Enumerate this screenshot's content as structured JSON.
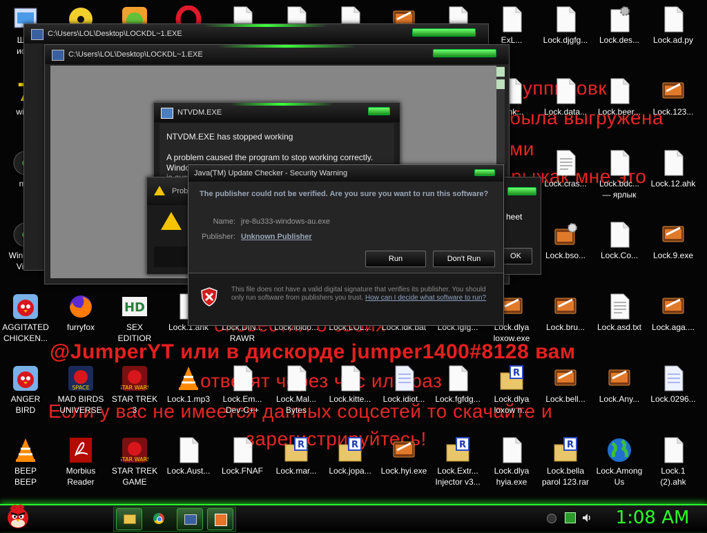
{
  "desktop": {
    "icons": [
      {
        "label": "Шоб\nиспр",
        "kind": "shortcut",
        "col": 0,
        "row": 0
      },
      {
        "label": "",
        "kind": "disc",
        "col": 1,
        "row": 0
      },
      {
        "label": "",
        "kind": "app-green",
        "col": 2,
        "row": 0
      },
      {
        "label": "",
        "kind": "opera",
        "col": 3,
        "row": 0
      },
      {
        "label": "",
        "kind": "file",
        "col": 4,
        "row": 0
      },
      {
        "label": "",
        "kind": "file",
        "col": 5,
        "row": 0
      },
      {
        "label": "",
        "kind": "file",
        "col": 6,
        "row": 0
      },
      {
        "label": "",
        "kind": "script",
        "col": 7,
        "row": 0
      },
      {
        "label": "",
        "kind": "file",
        "col": 8,
        "row": 0
      },
      {
        "label": "ExL...",
        "kind": "file",
        "col": 9,
        "row": 0
      },
      {
        "label": "Lock.djgfg...",
        "kind": "file",
        "col": 10,
        "row": 0
      },
      {
        "label": "Lock.des...",
        "kind": "gear-file",
        "col": 11,
        "row": 0
      },
      {
        "label": "Lock.ad.py",
        "kind": "file",
        "col": 12,
        "row": 0
      },
      {
        "label": "winlo",
        "kind": "seven",
        "col": 0,
        "row": 1
      },
      {
        "label": "elink...",
        "kind": "file",
        "col": 9,
        "row": 1
      },
      {
        "label": "Lock.data...",
        "kind": "file",
        "col": 10,
        "row": 1
      },
      {
        "label": "Lock.beer...",
        "kind": "file",
        "col": 11,
        "row": 1
      },
      {
        "label": "Lock.123...",
        "kind": "script",
        "col": 12,
        "row": 1
      },
      {
        "label": "mis",
        "kind": "disc-dark",
        "col": 0,
        "row": 2
      },
      {
        "label": "Lock.cras...",
        "kind": "doc",
        "col": 10,
        "row": 2
      },
      {
        "label": "Lock.bdc...\n— ярлык",
        "kind": "file",
        "col": 11,
        "row": 2
      },
      {
        "label": "Lock.12.ahk",
        "kind": "file",
        "col": 12,
        "row": 2
      },
      {
        "label": "Windows\nVista",
        "kind": "disc-dark",
        "col": 0,
        "row": 3
      },
      {
        "label": "Lock.bso...",
        "kind": "gear-script",
        "col": 10,
        "row": 3
      },
      {
        "label": "Lock.Co...",
        "kind": "file",
        "col": 11,
        "row": 3
      },
      {
        "label": "Lock.9.exe",
        "kind": "script",
        "col": 12,
        "row": 3
      },
      {
        "label": "AGGITATED\nCHICKEN...",
        "kind": "angry",
        "col": 0,
        "row": 4
      },
      {
        "label": "furryfox",
        "kind": "firefox",
        "col": 1,
        "row": 4
      },
      {
        "label": "SEX\nEDITIOR",
        "kind": "hd",
        "col": 2,
        "row": 4
      },
      {
        "label": "Lock.1.ahk",
        "kind": "file",
        "col": 3,
        "row": 4
      },
      {
        "label": "Lock.DIN...\nRAWR",
        "kind": "file",
        "col": 4,
        "row": 4
      },
      {
        "label": "Lock.loldo...",
        "kind": "file",
        "col": 5,
        "row": 4
      },
      {
        "label": "Lock.LOL...",
        "kind": "file",
        "col": 6,
        "row": 4
      },
      {
        "label": "Lock.idk.bat",
        "kind": "gear-file",
        "col": 7,
        "row": 4
      },
      {
        "label": "Lock.fgfg...",
        "kind": "file",
        "col": 8,
        "row": 4
      },
      {
        "label": "Lock.dlya\nloxow.exe",
        "kind": "script",
        "col": 9,
        "row": 4
      },
      {
        "label": "Lock.bru...",
        "kind": "script",
        "col": 10,
        "row": 4
      },
      {
        "label": "Lock.asd.txt",
        "kind": "doc",
        "col": 11,
        "row": 4
      },
      {
        "label": "Lock.aga....",
        "kind": "script",
        "col": 12,
        "row": 4
      },
      {
        "label": "ANGER\nBIRD",
        "kind": "angry",
        "col": 0,
        "row": 5
      },
      {
        "label": "MAD BIRDS\nUNIVERSE",
        "kind": "space",
        "col": 1,
        "row": 5
      },
      {
        "label": "STAR TREK\n3",
        "kind": "starwars",
        "col": 2,
        "row": 5
      },
      {
        "label": "Lock.1.mp3",
        "kind": "vlc",
        "col": 3,
        "row": 5
      },
      {
        "label": "Lock.Em...\nDev-C++",
        "kind": "file",
        "col": 4,
        "row": 5
      },
      {
        "label": "Lock.Mal...\nBytes",
        "kind": "file",
        "col": 5,
        "row": 5
      },
      {
        "label": "Lock.kitte...",
        "kind": "file",
        "col": 6,
        "row": 5
      },
      {
        "label": "Lock.idiot...",
        "kind": "page",
        "col": 7,
        "row": 5
      },
      {
        "label": "Lock.fgfdg...",
        "kind": "file",
        "col": 8,
        "row": 5
      },
      {
        "label": "Lock.dlya\nloxow n...",
        "kind": "r-folder",
        "col": 9,
        "row": 5
      },
      {
        "label": "Lock.bell...",
        "kind": "script",
        "col": 10,
        "row": 5
      },
      {
        "label": "Lock.Any...",
        "kind": "script",
        "col": 11,
        "row": 5
      },
      {
        "label": "Lock.0296...",
        "kind": "page",
        "col": 12,
        "row": 5
      },
      {
        "label": "BEEP\nBEEP",
        "kind": "vlc",
        "col": 0,
        "row": 6
      },
      {
        "label": "Morbius\nReader",
        "kind": "pdf",
        "col": 1,
        "row": 6
      },
      {
        "label": "STAR TREK\nGAME",
        "kind": "starwars",
        "col": 2,
        "row": 6
      },
      {
        "label": "Lock.Aust...",
        "kind": "file",
        "col": 3,
        "row": 6
      },
      {
        "label": "Lock.FNAF",
        "kind": "file",
        "col": 4,
        "row": 6
      },
      {
        "label": "Lock.mar...",
        "kind": "r-folder",
        "col": 5,
        "row": 6
      },
      {
        "label": "Lock.jopa...",
        "kind": "r-folder",
        "col": 6,
        "row": 6
      },
      {
        "label": "Lock.hyi.exe",
        "kind": "script",
        "col": 7,
        "row": 6
      },
      {
        "label": "Lock.Extr...\nInjector v3...",
        "kind": "r-folder",
        "col": 8,
        "row": 6
      },
      {
        "label": "Lock.dlya\nhyia.exe",
        "kind": "file",
        "col": 9,
        "row": 6
      },
      {
        "label": "Lock.bella\nparol 123.rar",
        "kind": "r-folder",
        "col": 10,
        "row": 6
      },
      {
        "label": "Lock.Among\nUs",
        "kind": "globe",
        "col": 11,
        "row": 6
      },
      {
        "label": "Lock.1\n(2).ahk",
        "kind": "file",
        "col": 12,
        "row": 6
      }
    ],
    "wallpaper_message": [
      "й группировк",
      "была выгружена",
      "ми",
      "рыжак мне это",
      "оповестил о своих",
      "@JumperYT или в дискорде jumper1400#8128 вам",
      "ответят через час или раз",
      "Если у вас не имеется данных соцсетей то скачайте и",
      "зарегистрируйтесь!"
    ]
  },
  "windows": {
    "console_back": {
      "title": "C:\\Users\\LOL\\Desktop\\LOCKDL~1.EXE"
    },
    "console_front": {
      "title": "C:\\Users\\LOL\\Desktop\\LOCKDL~1.EXE"
    },
    "ntvdm": {
      "title": "NTVDM.EXE",
      "heading": "NTVDM.EXE has stopped working",
      "line1": "A problem caused the program to stop working correctly.",
      "line2": "Windo",
      "line3": "is ava"
    },
    "problem": {
      "title": "Prob",
      "side_text": "heet",
      "ok_label": "OK"
    },
    "java": {
      "title": "Java(TM) Update Checker - Security Warning",
      "question": "The publisher could not be verified.  Are you sure you want to run this software?",
      "name_label": "Name:",
      "name_value": "jre-8u333-windows-au.exe",
      "publisher_label": "Publisher:",
      "publisher_value": "Unknown Publisher",
      "run_label": "Run",
      "dont_run_label": "Don't Run",
      "footer_text": "This file does not have a valid digital signature that verifies its publisher. You should only run software from publishers you trust.",
      "footer_link": "How can I decide what software to run?"
    }
  },
  "taskbar": {
    "clock": "1:08 AM",
    "items": [
      "explorer",
      "chrome",
      "lockdl",
      "script-editor"
    ]
  }
}
